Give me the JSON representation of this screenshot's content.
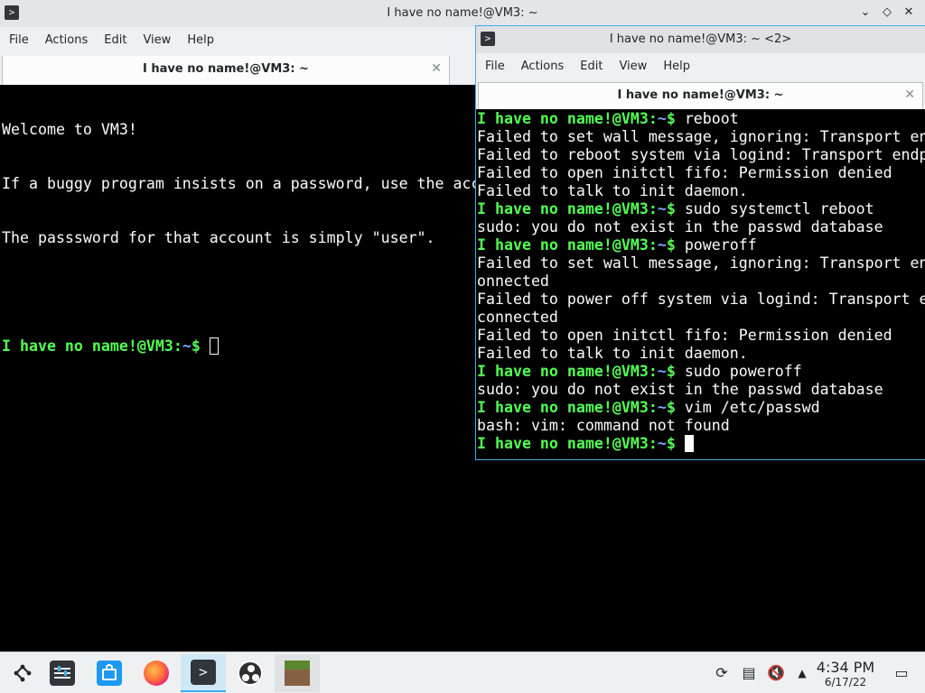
{
  "win1": {
    "title": "I have no name!@VM3: ~",
    "menu": [
      "File",
      "Actions",
      "Edit",
      "View",
      "Help"
    ],
    "tab_label": "I have no name!@VM3: ~",
    "lines": [
      "Welcome to VM3!",
      "If a buggy program insists on a password, use the account \"user\".",
      "The passsword for that account is simply \"user\"."
    ],
    "prompt_user": "I have no name!@VM3",
    "prompt_sep": ":",
    "prompt_cwd": "~",
    "prompt_end": "$ "
  },
  "win2": {
    "title": "I have no name!@VM3: ~ <2>",
    "menu": [
      "File",
      "Actions",
      "Edit",
      "View",
      "Help"
    ],
    "tab_label": "I have no name!@VM3: ~",
    "lines": [
      {
        "prompt": true,
        "text": "reboot"
      },
      {
        "prompt": false,
        "text": "Failed to set wall message, ignoring: Transport endpoint is not connected"
      },
      {
        "prompt": false,
        "text": "Failed to reboot system via logind: Transport endpoint is not connected"
      },
      {
        "prompt": false,
        "text": "Failed to open initctl fifo: Permission denied"
      },
      {
        "prompt": false,
        "text": "Failed to talk to init daemon."
      },
      {
        "prompt": true,
        "text": "sudo systemctl reboot"
      },
      {
        "prompt": false,
        "text": "sudo: you do not exist in the passwd database"
      },
      {
        "prompt": true,
        "text": "poweroff"
      },
      {
        "prompt": false,
        "text": "Failed to set wall message, ignoring: Transport endpoint is not c"
      },
      {
        "prompt": false,
        "text": "onnected"
      },
      {
        "prompt": false,
        "text": "Failed to power off system via logind: Transport endpoint is not "
      },
      {
        "prompt": false,
        "text": "connected"
      },
      {
        "prompt": false,
        "text": "Failed to open initctl fifo: Permission denied"
      },
      {
        "prompt": false,
        "text": "Failed to talk to init daemon."
      },
      {
        "prompt": true,
        "text": "sudo poweroff"
      },
      {
        "prompt": false,
        "text": "sudo: you do not exist in the passwd database"
      },
      {
        "prompt": true,
        "text": "vim /etc/passwd"
      },
      {
        "prompt": false,
        "text": "bash: vim: command not found"
      },
      {
        "prompt": true,
        "text": ""
      }
    ]
  },
  "taskbar": {
    "apps": [
      {
        "name": "application-launcher-icon",
        "color": "#eff0f1"
      },
      {
        "name": "system-settings-icon",
        "color": "#31363b"
      },
      {
        "name": "discover-store-icon",
        "color": "#1d99f3"
      },
      {
        "name": "firefox-icon",
        "color": "#ff7139"
      },
      {
        "name": "konsole-icon",
        "color": "#31363b"
      },
      {
        "name": "obs-studio-icon",
        "color": "#302e31"
      },
      {
        "name": "minecraft-icon",
        "color": "#5b8731"
      }
    ],
    "time": "4:34 PM",
    "date": "6/17/22"
  }
}
